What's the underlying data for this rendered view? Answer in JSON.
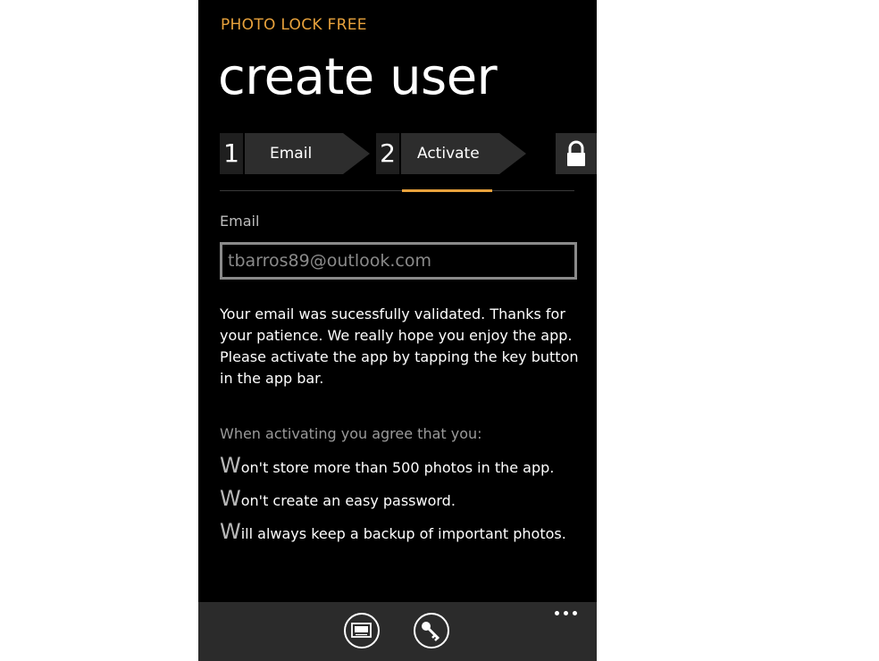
{
  "app_title": "PHOTO LOCK FREE",
  "page_title": "create user",
  "steps": [
    {
      "number": "1",
      "label": "Email"
    },
    {
      "number": "2",
      "label": "Activate"
    }
  ],
  "email_field": {
    "label": "Email",
    "value": "tbarros89@outlook.com"
  },
  "message": "Your email was sucessfully validated. Thanks for your patience. We really hope you enjoy the app. Please activate the app by tapping the key button in the app bar.",
  "agreement": {
    "intro": "When activating you agree that you:",
    "terms": [
      {
        "cap": "W",
        "rest": "on't store more than 500 photos in the app."
      },
      {
        "cap": "W",
        "rest": "on't create an easy password."
      },
      {
        "cap": "W",
        "rest": "ill always keep a backup of important photos."
      }
    ]
  },
  "app_bar": {
    "buttons": [
      "keyboard-abc-icon",
      "key-icon"
    ],
    "more": "more-options-icon"
  },
  "colors": {
    "accent": "#e8a23c",
    "background": "#000000",
    "app_bar": "#2b2b2b",
    "tile": "#2d2d2d"
  }
}
